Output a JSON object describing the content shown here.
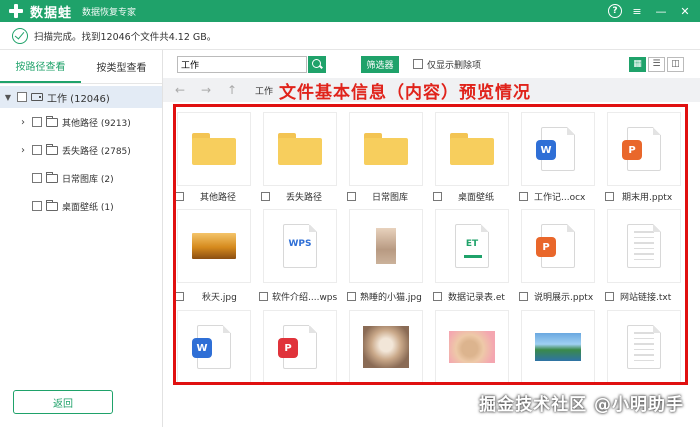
{
  "app": {
    "name": "数据蛙",
    "subtitle": "数据恢复专家"
  },
  "window_controls": {
    "help": "?",
    "menu": "≡",
    "minimize": "—",
    "close": "✕"
  },
  "status": {
    "text": "扫描完成。找到12046个文件共4.12 GB。"
  },
  "sidebar": {
    "tabs": [
      {
        "label": "按路径查看",
        "active": true
      },
      {
        "label": "按类型查看",
        "active": false
      }
    ],
    "root": {
      "label": "工作 (12046)"
    },
    "items": [
      {
        "label": "其他路径 (9213)",
        "expandable": true
      },
      {
        "label": "丢失路径 (2785)",
        "expandable": true
      },
      {
        "label": "日常图库 (2)",
        "expandable": false
      },
      {
        "label": "桌面壁纸 (1)",
        "expandable": false
      }
    ],
    "back_button": "返回"
  },
  "toolbar": {
    "search_value": "工作",
    "filter_button": "筛选器",
    "only_deleted_label": "仅显示删除项"
  },
  "nav": {
    "back": "←",
    "forward": "→",
    "up": "↑",
    "breadcrumb": "工作",
    "banner": "文件基本信息（内容）预览情况"
  },
  "files": [
    {
      "name": "其他路径",
      "icon": "folder-icon"
    },
    {
      "name": "丢失路径",
      "icon": "folder-icon"
    },
    {
      "name": "日常图库",
      "icon": "folder-icon"
    },
    {
      "name": "桌面壁纸",
      "icon": "folder-icon"
    },
    {
      "name": "工作记...ocx",
      "icon": "word-doc-icon",
      "badge": "W"
    },
    {
      "name": "期末用.pptx",
      "icon": "ppt-doc-icon",
      "badge": "P"
    },
    {
      "name": "秋天.jpg",
      "icon": "autumn-photo-thumbnail"
    },
    {
      "name": "软件介绍....wps",
      "icon": "wps-doc-icon",
      "badge": "WPS"
    },
    {
      "name": "熟睡的小猫.jpg",
      "icon": "cat-photo-thumbnail"
    },
    {
      "name": "数据记录表.et",
      "icon": "et-sheet-icon",
      "badge": "ET"
    },
    {
      "name": "说明展示.pptx",
      "icon": "ppt-doc-icon",
      "badge": "P"
    },
    {
      "name": "网站链接.txt",
      "icon": "text-doc-icon"
    },
    {
      "name": "",
      "icon": "word-doc-icon",
      "badge": "W"
    },
    {
      "name": "",
      "icon": "pdf-doc-icon",
      "badge": "P"
    },
    {
      "name": "",
      "icon": "cat-photo-thumbnail"
    },
    {
      "name": "",
      "icon": "rabbit-photo-thumbnail"
    },
    {
      "name": "",
      "icon": "lake-photo-thumbnail"
    },
    {
      "name": "",
      "icon": "text-doc-icon"
    }
  ],
  "watermark": "掘金技术社区 @小明助手",
  "colors": {
    "brand_green": "#1fa26a",
    "highlight_red": "#e01010",
    "tree_selected_bg": "#e3ebf5"
  }
}
